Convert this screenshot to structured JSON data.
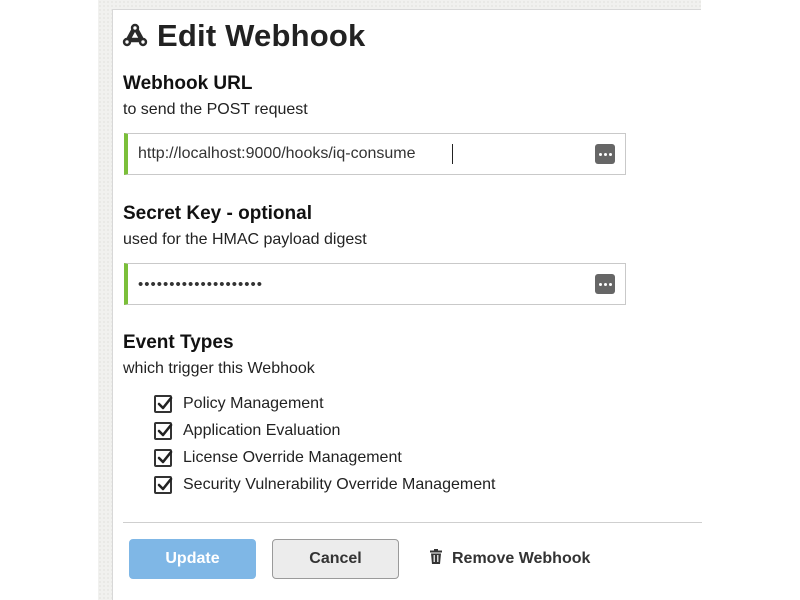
{
  "dialog": {
    "title": "Edit Webhook",
    "title_icon": "webhook-icon"
  },
  "url_section": {
    "label": "Webhook URL",
    "sublabel": "to send the POST request",
    "value": "http://localhost:9000/hooks/iq-consume",
    "manager_icon": "password-manager-icon"
  },
  "secret_section": {
    "label": "Secret Key - optional",
    "sublabel": "used for the HMAC payload digest",
    "value": "••••••••••••••••••••",
    "manager_icon": "password-manager-icon"
  },
  "events_section": {
    "label": "Event Types",
    "sublabel": "which trigger this Webhook",
    "items": [
      {
        "label": "Policy Management",
        "checked": true
      },
      {
        "label": "Application Evaluation",
        "checked": true
      },
      {
        "label": "License Override Management",
        "checked": true
      },
      {
        "label": "Security Vulnerability Override Management",
        "checked": true
      }
    ]
  },
  "actions": {
    "update_label": "Update",
    "cancel_label": "Cancel",
    "remove_label": "Remove Webhook",
    "remove_icon": "trash-icon"
  },
  "colors": {
    "accent_valid": "#7bbf3a",
    "primary_button": "#7fb7e6"
  }
}
